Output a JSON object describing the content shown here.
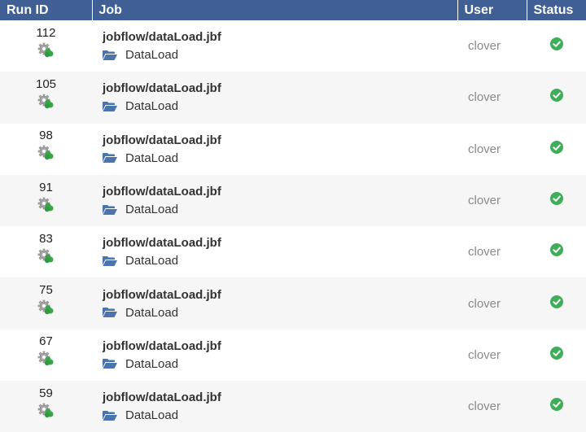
{
  "table": {
    "headers": [
      "Run ID",
      "Job",
      "User",
      "Status"
    ],
    "rows": [
      {
        "run_id": "112",
        "job": "jobflow/dataLoad.jbf",
        "sandbox": "DataLoad",
        "user": "clover",
        "status": "success"
      },
      {
        "run_id": "105",
        "job": "jobflow/dataLoad.jbf",
        "sandbox": "DataLoad",
        "user": "clover",
        "status": "success"
      },
      {
        "run_id": "98",
        "job": "jobflow/dataLoad.jbf",
        "sandbox": "DataLoad",
        "user": "clover",
        "status": "success"
      },
      {
        "run_id": "91",
        "job": "jobflow/dataLoad.jbf",
        "sandbox": "DataLoad",
        "user": "clover",
        "status": "success"
      },
      {
        "run_id": "83",
        "job": "jobflow/dataLoad.jbf",
        "sandbox": "DataLoad",
        "user": "clover",
        "status": "success"
      },
      {
        "run_id": "75",
        "job": "jobflow/dataLoad.jbf",
        "sandbox": "DataLoad",
        "user": "clover",
        "status": "success"
      },
      {
        "run_id": "67",
        "job": "jobflow/dataLoad.jbf",
        "sandbox": "DataLoad",
        "user": "clover",
        "status": "success"
      },
      {
        "run_id": "59",
        "job": "jobflow/dataLoad.jbf",
        "sandbox": "DataLoad",
        "user": "clover",
        "status": "success"
      }
    ]
  },
  "icons": {
    "run_type": "gear-run-icon",
    "sandbox": "folder-open-icon",
    "status_success": "check-circle-icon"
  },
  "colors": {
    "header_bg": "#3f5f95",
    "status_success": "#3fae5a",
    "folder": "#4b74ad"
  }
}
